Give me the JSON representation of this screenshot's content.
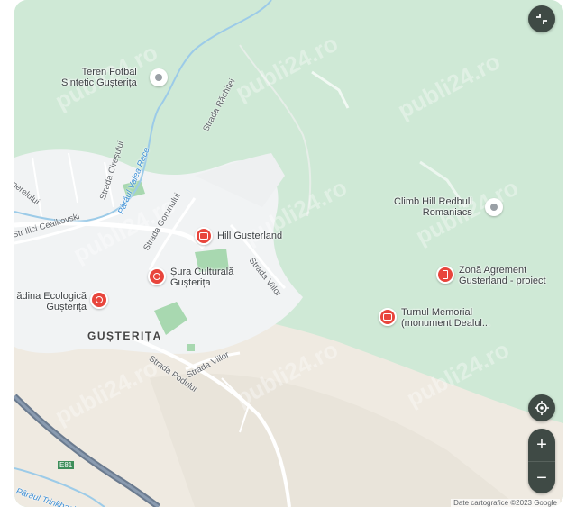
{
  "map": {
    "pois": [
      {
        "name": "Teren Fotbal Sintetic Gușterița",
        "line1": "Teren Fotbal",
        "line2": "Sintetic Gușterița",
        "type": "grey"
      },
      {
        "name": "Climb Hill Redbull Romaniacs",
        "line1": "Climb Hill Redbull",
        "line2": "Romaniacs",
        "type": "grey"
      },
      {
        "name": "Hill Gusterland",
        "line1": "Hill Gusterland",
        "type": "red-hotel"
      },
      {
        "name": "Șura Culturală Gușterița",
        "line1": "Șura Culturală",
        "line2": "Gușterița",
        "type": "red"
      },
      {
        "name": "Grădina Ecologică Gușterița",
        "line1": "ădina Ecologică",
        "line2": "Gușterița",
        "type": "red"
      },
      {
        "name": "Zonă Agrement Gusterland - proiect",
        "line1": "Zonă Agrement",
        "line2": "Gusterland - proiect",
        "type": "red"
      },
      {
        "name": "Turnul Memorial (monument Dealul...",
        "line1": "Turnul Memorial",
        "line2": "(monument Dealul...",
        "type": "red-camera"
      }
    ],
    "town_label": "GUȘTERIȚA",
    "streets": {
      "rachitei": "Strada Răchitei",
      "cirepului": "Strada Cireșului",
      "valea_rece": "Pârâul Valea Rece",
      "ceaikovski": "Str Ilici Ceaikovski",
      "upper_left": "nerelului",
      "gorunului": "Strada Gorunului",
      "viilor_upper": "Strada Viilor",
      "viilor_lower": "Strada Viilor",
      "podului": "Strada Podului",
      "trinkbach": "Pârâul Trinkbach",
      "route": "E81"
    },
    "watermark_text": "publi24.ro",
    "attribution": "Date cartografice ©2023 Google"
  },
  "controls": {
    "fullscreen_icon": "collapse-icon",
    "locate_icon": "my-location-icon",
    "zoom_in": "+",
    "zoom_out": "−"
  }
}
